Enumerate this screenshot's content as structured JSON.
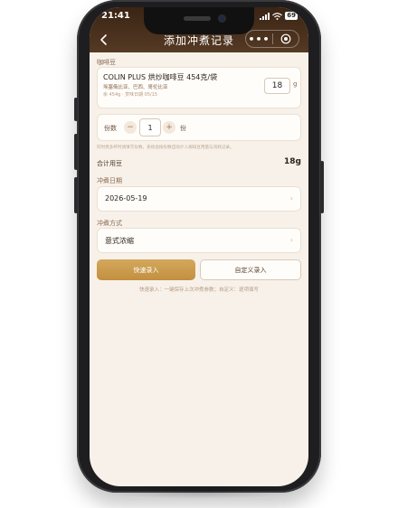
{
  "status_bar": {
    "time": "21:41",
    "battery": "69"
  },
  "nav": {
    "title": "添加冲煮记录",
    "more": "•••"
  },
  "bean": {
    "section_label": "咖啡豆",
    "name": "COLIN PLUS 烘炒咖啡豆 454克/袋",
    "origin": "埃塞俄比亚、巴西、哥伦比亚",
    "meta": "余 454g · 赏味日期 05/15",
    "dose": "18",
    "dose_unit": "g"
  },
  "quantity": {
    "label": "份数",
    "minus": "−",
    "value": "1",
    "plus": "+",
    "unit": "份"
  },
  "hint": "同时煮多杯时请填写份数，系统会按份数自动计入咖啡豆用量与消耗记录。",
  "total": {
    "label": "合计用豆",
    "value": "18g"
  },
  "brew_date": {
    "label": "冲煮日期",
    "value": "2026-05-19",
    "chevron": "›"
  },
  "brew_method": {
    "label": "冲煮方式",
    "value": "意式浓缩",
    "chevron": "›"
  },
  "actions": {
    "quick": "快速录入",
    "custom": "自定义录入"
  },
  "footnote": "快速录入：一键保存上次冲煮参数；自定义：逐项填写",
  "icons": {
    "back": "chevron-left-icon",
    "target": "target-icon",
    "signal": "signal-icon",
    "wifi": "wifi-icon"
  },
  "colors": {
    "header": "#3a2414",
    "accent": "#c8974a",
    "background": "#f7f1ea"
  }
}
